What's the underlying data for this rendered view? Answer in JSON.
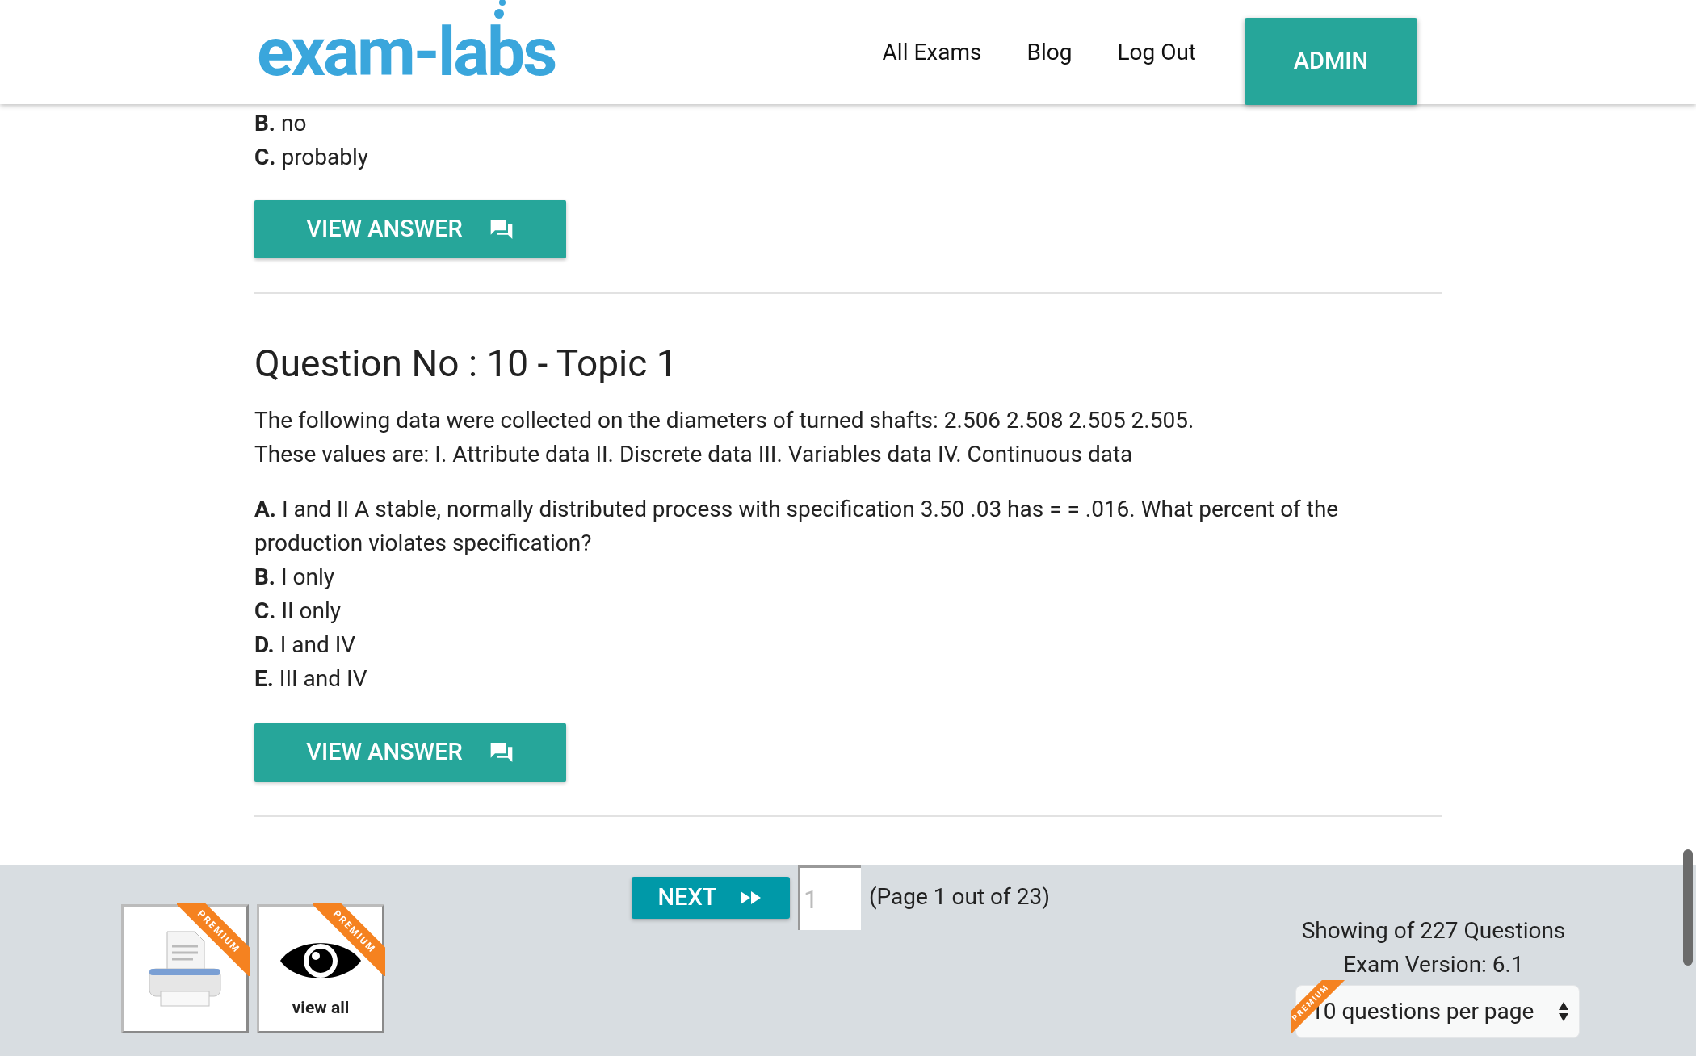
{
  "header": {
    "logo": "exam-labs",
    "nav": [
      {
        "label": "All Exams"
      },
      {
        "label": "Blog"
      },
      {
        "label": "Log Out"
      }
    ],
    "admin_button": "ADMIN"
  },
  "previous_question": {
    "options": [
      {
        "letter": "B.",
        "text": "no"
      },
      {
        "letter": "C.",
        "text": "probably"
      }
    ],
    "button": "VIEW ANSWER"
  },
  "question": {
    "title": "Question No : 10 - Topic 1",
    "text": "The following data were collected on the diameters of turned shafts: 2.506 2.508 2.505 2.505. These values are: I. Attribute data II. Discrete data III. Variables data IV. Continuous data",
    "options": [
      {
        "letter": "A.",
        "text": "I and II A stable, normally distributed process with specification 3.50 .03 has = = .016. What percent of the production violates specification?"
      },
      {
        "letter": "B.",
        "text": "I only"
      },
      {
        "letter": "C.",
        "text": "II only"
      },
      {
        "letter": "D.",
        "text": "I and IV"
      },
      {
        "letter": "E.",
        "text": "III and IV"
      }
    ],
    "button": "VIEW ANSWER"
  },
  "footer": {
    "tools": [
      {
        "kind": "print",
        "badge": "PREMIUM"
      },
      {
        "kind": "view",
        "badge": "PREMIUM",
        "label": "view all"
      }
    ],
    "next_button": "NEXT",
    "page_input": {
      "placeholder": "1"
    },
    "page_info": "(Page 1 out of 23)",
    "showing": "Showing of 227 Questions",
    "version": "Exam Version: 6.1",
    "per_page": {
      "badge": "PREMIUM",
      "value": "10 questions per page"
    }
  }
}
